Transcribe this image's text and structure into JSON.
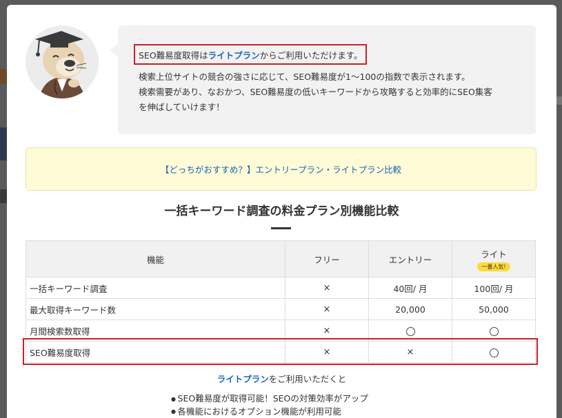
{
  "bubble": {
    "headline_prefix": "SEO難易度取得は",
    "headline_link": "ライトプラン",
    "headline_suffix": "からご利用いただけます。",
    "description_lines": [
      "検索上位サイトの競合の強さに応じて、SEO難易度が1〜100の指数で表示されます。",
      "検索需要があり、なおかつ、SEO難易度の低いキーワードから攻略すると効率的にSEO集客",
      "を伸ばしていけます！"
    ]
  },
  "notice": {
    "link_text": "【どっちがおすすめ？】エントリープラン・ライトプラン比較"
  },
  "section_title": "一括キーワード調査の料金プラン別機能比較",
  "table": {
    "headers": {
      "feature": "機能",
      "free": "フリー",
      "entry": "エントリー",
      "lite": "ライト",
      "lite_badge": "一番人気!"
    },
    "rows": [
      {
        "feature": "一括キーワード調査",
        "free": "×",
        "entry": "40回/ 月",
        "lite": "100回/ 月"
      },
      {
        "feature": "最大取得キーワード数",
        "free": "×",
        "entry": "20,000",
        "lite": "50,000"
      },
      {
        "feature": "月間検索数取得",
        "free": "×",
        "entry": "○",
        "lite": "○"
      },
      {
        "feature": "SEO難易度取得",
        "free": "×",
        "entry": "×",
        "lite": "○"
      }
    ]
  },
  "cta": {
    "link": "ライトプラン",
    "suffix": "をご利用いただくと"
  },
  "benefits": [
    "SEO難易度が取得可能！SEOの対策効率がアップ",
    "各機能におけるオプション機能が利用可能"
  ],
  "colors": {
    "link": "#1a63b8",
    "highlight": "#cc1f26",
    "notice_bg": "#fefbd6",
    "badge": "#ffd93b"
  },
  "mascot": {
    "icon": "sea-otter-graduate-icon"
  }
}
